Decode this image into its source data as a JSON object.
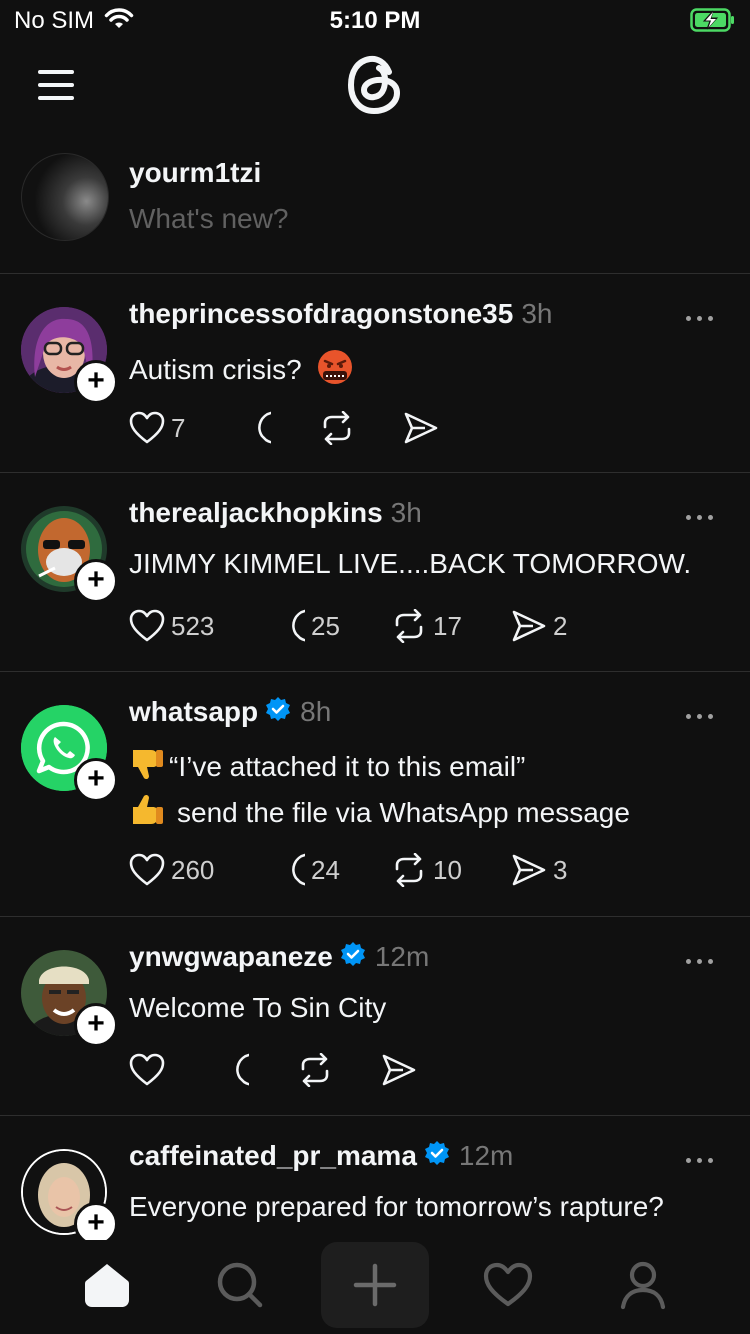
{
  "status_bar": {
    "carrier": "No SIM",
    "time": "5:10 PM"
  },
  "composer": {
    "username": "yourm1tzi",
    "placeholder": "What's new?"
  },
  "posts": [
    {
      "username": "theprincessofdragonstone35",
      "time": "3h",
      "verified": false,
      "lines": [
        "Autism crisis?"
      ],
      "likes": "7",
      "replies": "",
      "reposts": "",
      "shares": ""
    },
    {
      "username": "therealjackhopkins",
      "time": "3h",
      "verified": false,
      "lines": [
        "JIMMY KIMMEL LIVE....BACK TOMORROW."
      ],
      "likes": "523",
      "replies": "25",
      "reposts": "17",
      "shares": "2"
    },
    {
      "username": "whatsapp",
      "time": "8h",
      "verified": true,
      "lines": [
        "“I’ve attached it to this email”",
        "send the file via WhatsApp message"
      ],
      "likes": "260",
      "replies": "24",
      "reposts": "10",
      "shares": "3"
    },
    {
      "username": "ynwgwapaneze",
      "time": "12m",
      "verified": true,
      "lines": [
        "Welcome To Sin City"
      ],
      "likes": "",
      "replies": "",
      "reposts": "",
      "shares": ""
    },
    {
      "username": "caffeinated_pr_mama",
      "time": "12m",
      "verified": true,
      "lines": [
        "Everyone prepared for tomorrow’s rapture?"
      ]
    }
  ],
  "icons": {
    "emoji_1": "face-with-symbols-emoji",
    "emoji_2": "thumbs-down-emoji",
    "emoji_3": "thumbs-up-emoji"
  },
  "colors": {
    "background": "#101010",
    "verified": "#0095f6",
    "battery": "#4cd964",
    "whatsapp": "#25d366"
  }
}
